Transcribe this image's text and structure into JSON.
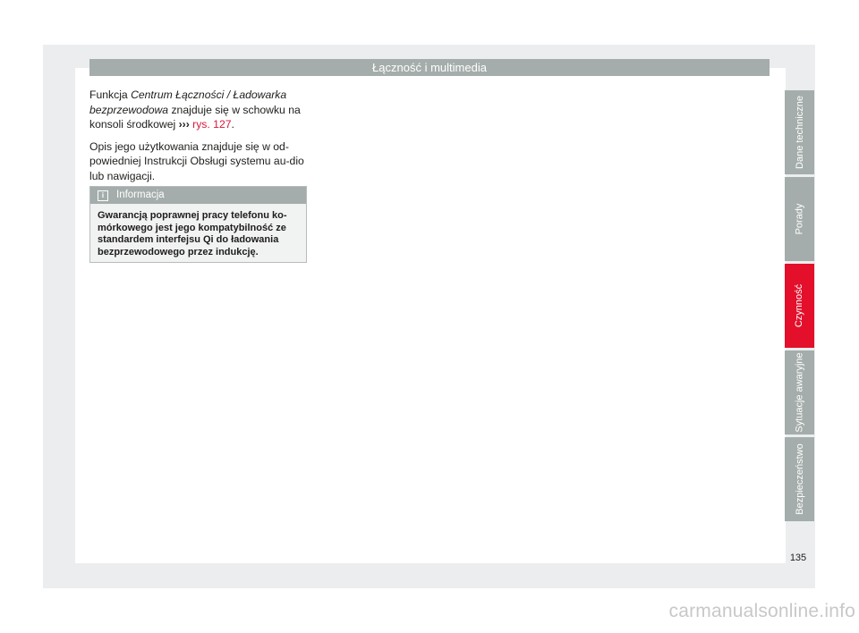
{
  "header": {
    "title": "Łączność i multimedia"
  },
  "body": {
    "p1": {
      "lead": "Funkcja ",
      "italic": "Centrum Łączności / Ładowarka bezprzewodowa",
      "rest": " znajduje się w schowku na konsoli środkowej ",
      "arrows": "›››",
      "link": " rys. 127",
      "end": "."
    },
    "p2": "Opis jego użytkowania znajduje się w od-powiedniej Instrukcji Obsługi systemu au-dio lub nawigacji."
  },
  "info_box": {
    "icon": "info-icon",
    "title": "Informacja",
    "text": "Gwarancją poprawnej pracy telefonu ko-mórkowego jest jego kompatybilność ze standardem interfejsu Qi do ładowania bezprzewodowego przez indukcję."
  },
  "side_tabs": [
    {
      "label": "Dane techniczne",
      "active": false
    },
    {
      "label": "Porady",
      "active": false
    },
    {
      "label": "Czynność",
      "active": true
    },
    {
      "label": "Sytuacje awaryjne",
      "active": false
    },
    {
      "label": "Bezpieczeństwo",
      "active": false
    }
  ],
  "page_number": "135",
  "watermark": "carmanualsonline.info",
  "colors": {
    "accent": "#e30f2b",
    "link": "#d6173a",
    "bar": "#a4adab"
  }
}
